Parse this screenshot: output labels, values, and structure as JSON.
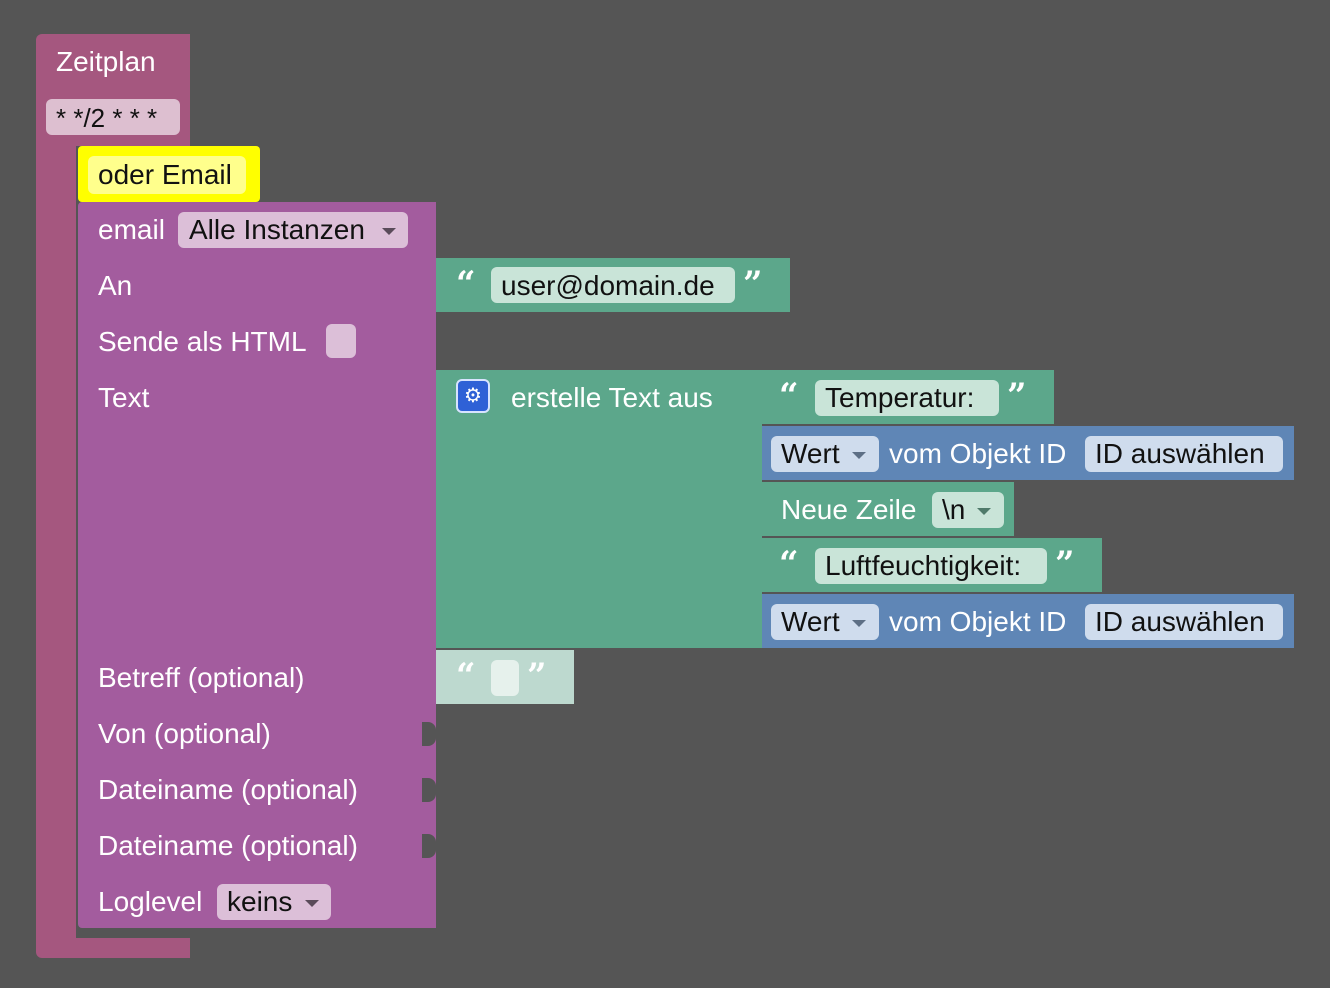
{
  "colors": {
    "background": "#555555",
    "zeitplan_block": "#a5577f",
    "email_block": "#a35c9e",
    "comment_highlight": "#ffff00",
    "text_block": "#5ca78b",
    "value_block": "#5f86b6"
  },
  "zeitplan": {
    "label": "Zeitplan",
    "cron": "* */2 * * *"
  },
  "comment": {
    "text": "oder Email"
  },
  "email": {
    "label": "email",
    "instance": "Alle Instanzen",
    "rows": {
      "to": "An",
      "as_html": "Sende als HTML",
      "text": "Text",
      "subject": "Betreff (optional)",
      "from": "Von (optional)",
      "file1": "Dateiname (optional)",
      "file2": "Dateiname (optional)",
      "loglevel": "Loglevel"
    },
    "loglevel_value": "keins"
  },
  "recipient": {
    "value": "user@domain.de"
  },
  "create_text": {
    "label": "erstelle Text aus",
    "gear_icon": "gear-icon",
    "items": {
      "temp_text": "Temperatur:",
      "value1": {
        "mode": "Wert",
        "label": "vom Objekt ID",
        "id": "ID auswählen"
      },
      "newline": {
        "label": "Neue Zeile",
        "value": "\\n"
      },
      "humidity_text": "Luftfeuchtigkeit:",
      "value2": {
        "mode": "Wert",
        "label": "vom Objekt ID",
        "id": "ID auswählen"
      }
    }
  },
  "subject_text": {
    "value": ""
  }
}
